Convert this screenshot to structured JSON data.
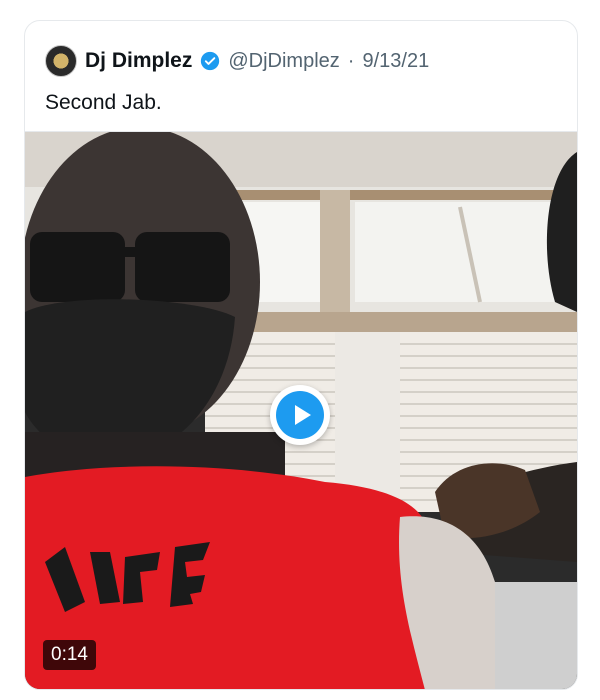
{
  "tweet": {
    "display_name": "Dj Dimplez",
    "handle": "@DjDimplez",
    "separator": "·",
    "date": "9/13/21",
    "text": "Second Jab."
  },
  "video": {
    "duration": "0:14"
  },
  "icons": {
    "verified": "verified-badge-icon",
    "play": "play-icon"
  },
  "colors": {
    "accent_blue": "#1d9bf0",
    "shirt_red": "#e31b23"
  }
}
